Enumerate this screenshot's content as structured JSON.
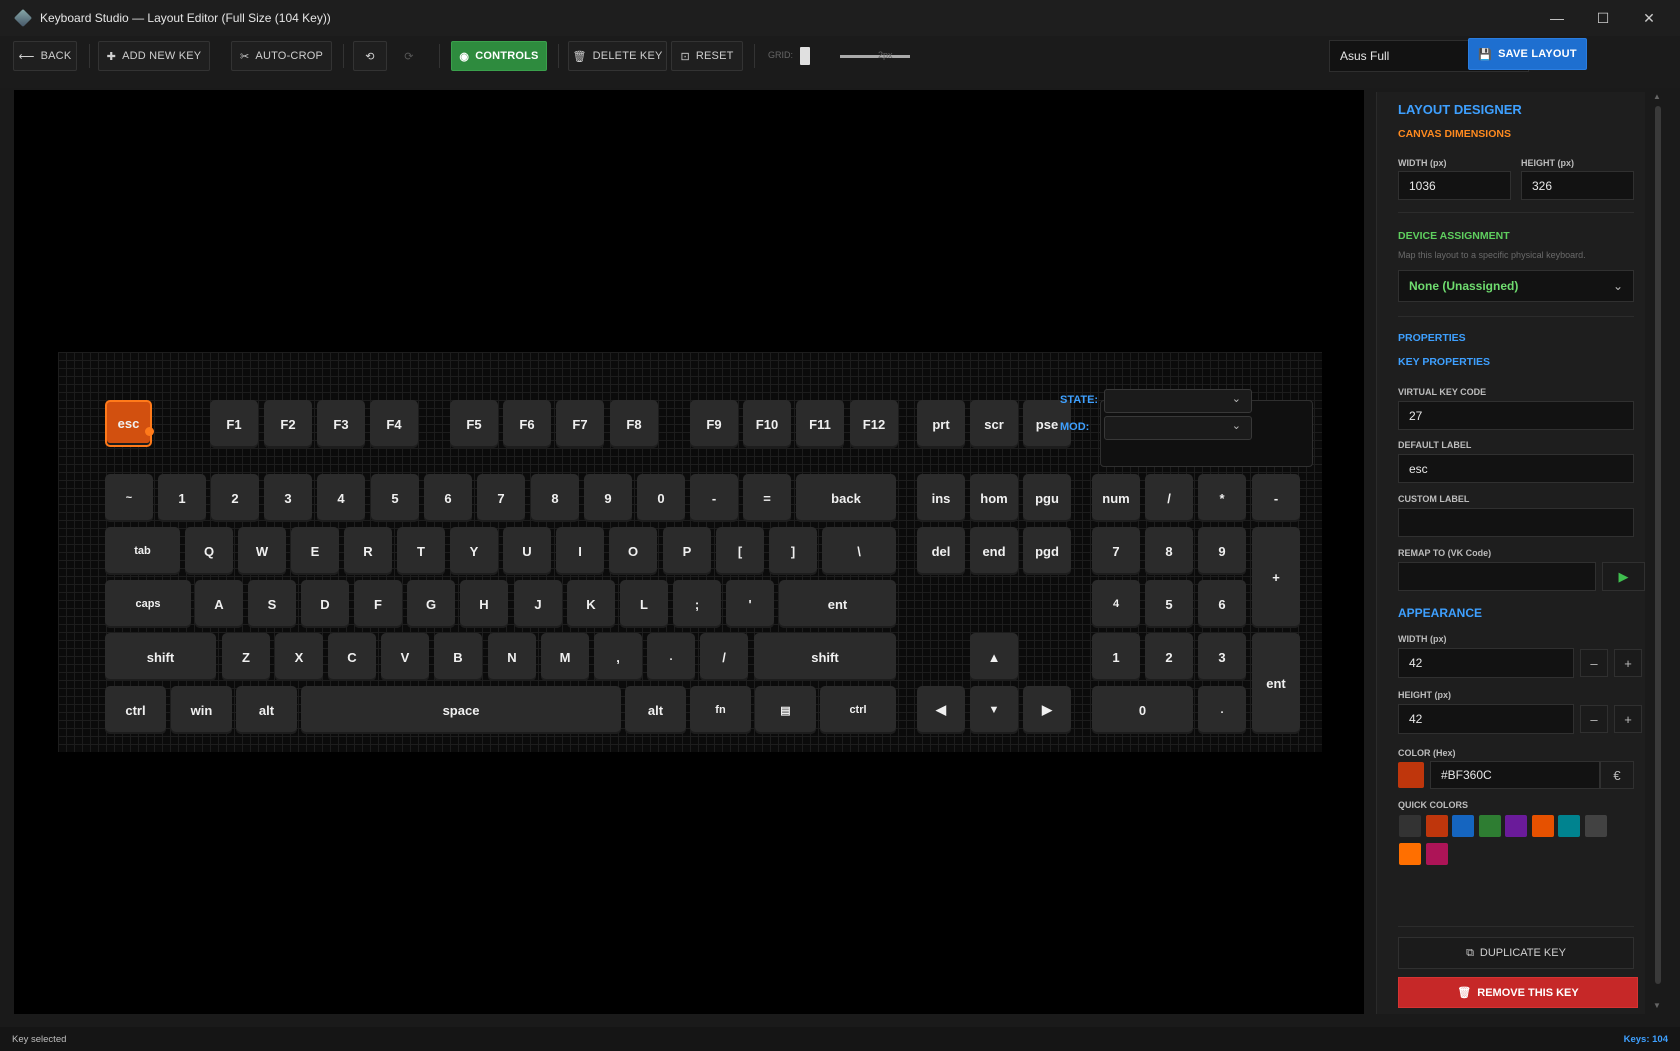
{
  "window": {
    "title": "Keyboard Studio — Layout Editor (Full Size (104 Key))",
    "minimize": "—",
    "maximize": "☐",
    "close": "✕"
  },
  "toolbar": {
    "back": "BACK",
    "add_new_key": "ADD NEW KEY",
    "auto_crop": "AUTO-CROP",
    "undo": "⟲",
    "redo": "⟳",
    "controls": "CONTROLS",
    "delete_key": "DELETE KEY",
    "reset": "RESET",
    "grid_label": "GRID:",
    "grid_value": "2px",
    "layout_name": "Asus Full",
    "save_layout": "SAVE LAYOUT"
  },
  "keyboard": {
    "keys": [
      "esc",
      "F1",
      "F2",
      "F3",
      "F4",
      "F5",
      "F6",
      "F7",
      "F8",
      "F9",
      "F10",
      "F11",
      "F12",
      "prt",
      "scr",
      "pse",
      "~",
      "1",
      "2",
      "3",
      "4",
      "5",
      "6",
      "7",
      "8",
      "9",
      "0",
      "-",
      "=",
      "back",
      "ins",
      "hom",
      "pgu",
      "num",
      "/",
      "*",
      "-",
      "tab",
      "Q",
      "W",
      "E",
      "R",
      "T",
      "Y",
      "U",
      "I",
      "O",
      "P",
      "[",
      "]",
      "\\",
      "del",
      "end",
      "pgd",
      "7",
      "8",
      "9",
      "+",
      "caps",
      "A",
      "S",
      "D",
      "F",
      "G",
      "H",
      "J",
      "K",
      "L",
      ";",
      "'",
      "ent",
      "4",
      "5",
      "6",
      "shift",
      "Z",
      "X",
      "C",
      "V",
      "B",
      "N",
      "M",
      ",",
      ".",
      "/",
      "shift",
      "▲",
      "1",
      "2",
      "3",
      "ent",
      "ctrl",
      "win",
      "alt",
      "space",
      "alt",
      "fn",
      "▤",
      "ctrl",
      "◀",
      "▼",
      "▶",
      "0",
      "."
    ],
    "selected_key": "esc",
    "state_label": "STATE:",
    "mod_label": "MOD:"
  },
  "panel": {
    "title": "LAYOUT DESIGNER",
    "canvas_dimensions": "CANVAS DIMENSIONS",
    "width_label": "WIDTH (px)",
    "width_value": "1036",
    "height_label": "HEIGHT (px)",
    "height_value": "326",
    "device_assignment": "DEVICE ASSIGNMENT",
    "device_hint": "Map this layout to a specific physical keyboard.",
    "device_value": "None (Unassigned)",
    "properties": "PROPERTIES",
    "key_properties": "KEY PROPERTIES",
    "vk_label": "VIRTUAL KEY CODE",
    "vk_value": "27",
    "default_label_label": "DEFAULT LABEL",
    "default_label_value": "esc",
    "custom_label_label": "CUSTOM LABEL",
    "custom_label_value": "",
    "remap_label": "REMAP TO (VK Code)",
    "remap_value": "",
    "appearance": "APPEARANCE",
    "ap_width_label": "WIDTH (px)",
    "ap_width_value": "42",
    "ap_height_label": "HEIGHT (px)",
    "ap_height_value": "42",
    "color_label": "COLOR (Hex)",
    "color_value": "#BF360C",
    "quick_colors_label": "QUICK COLORS",
    "quick_colors": [
      "#333333",
      "#BF360C",
      "#1565C0",
      "#2E7D32",
      "#6A1B9A",
      "#E65100",
      "#00838F",
      "#424242",
      "#FF6F00",
      "#AD1457"
    ],
    "duplicate_key": "DUPLICATE KEY",
    "remove_key": "REMOVE THIS KEY",
    "minus": "–",
    "plus": "+",
    "play": "▶",
    "euro": "€"
  },
  "status": {
    "left": "Key selected",
    "right": "Keys: 104"
  },
  "colors": {
    "accent_blue": "#3EA0FF",
    "accent_orange": "#FF8A1F",
    "accent_green": "#5FCF5F",
    "selected_key": "#D2500F",
    "remove_red": "#C62828"
  }
}
